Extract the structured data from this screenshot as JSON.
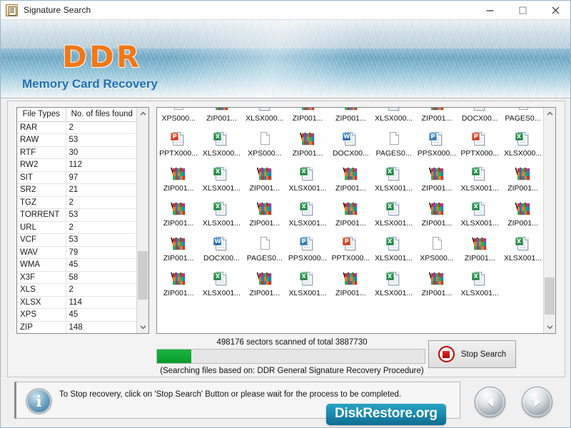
{
  "window": {
    "title": "Signature Search",
    "icon": "app-document-icon",
    "controls": {
      "minimize": "minimize-icon",
      "maximize": "maximize-icon",
      "close": "close-icon"
    }
  },
  "banner": {
    "logo": "DDR",
    "product_title": "Memory Card Recovery",
    "logo_color": "#f07818",
    "title_color": "#1f6fb5"
  },
  "file_types_table": {
    "headers": [
      "File Types",
      "No. of files found"
    ],
    "rows": [
      {
        "type": "RAR",
        "count": "2"
      },
      {
        "type": "RAW",
        "count": "53"
      },
      {
        "type": "RTF",
        "count": "30"
      },
      {
        "type": "RW2",
        "count": "112"
      },
      {
        "type": "SIT",
        "count": "97"
      },
      {
        "type": "SR2",
        "count": "21"
      },
      {
        "type": "TGZ",
        "count": "2"
      },
      {
        "type": "TORRENT",
        "count": "53"
      },
      {
        "type": "URL",
        "count": "2"
      },
      {
        "type": "VCF",
        "count": "53"
      },
      {
        "type": "WAV",
        "count": "79"
      },
      {
        "type": "WMA",
        "count": "45"
      },
      {
        "type": "X3F",
        "count": "58"
      },
      {
        "type": "XLS",
        "count": "2"
      },
      {
        "type": "XLSX",
        "count": "114"
      },
      {
        "type": "XPS",
        "count": "45"
      },
      {
        "type": "ZIP",
        "count": "148"
      }
    ]
  },
  "file_grid": {
    "columns": 9,
    "items": [
      {
        "label": "XPS000...",
        "icon": "xps-file-icon"
      },
      {
        "label": "ZIP001...",
        "icon": "zip-file-icon"
      },
      {
        "label": "XLSX000...",
        "icon": "xlsx-file-icon"
      },
      {
        "label": "ZIP001...",
        "icon": "zip-file-icon"
      },
      {
        "label": "ZIP001...",
        "icon": "zip-file-icon"
      },
      {
        "label": "XLSX000...",
        "icon": "xlsx-file-icon"
      },
      {
        "label": "ZIP001...",
        "icon": "zip-file-icon"
      },
      {
        "label": "DOCX00...",
        "icon": "docx-file-icon"
      },
      {
        "label": "PAGES0...",
        "icon": "pages-file-icon"
      },
      {
        "label": "PPTX000...",
        "icon": "pptx-file-icon"
      },
      {
        "label": "XLSX000...",
        "icon": "xlsx-file-icon"
      },
      {
        "label": "XPS000...",
        "icon": "xps-file-icon"
      },
      {
        "label": "ZIP001...",
        "icon": "zip-file-icon"
      },
      {
        "label": "DOCX00...",
        "icon": "docx-file-icon"
      },
      {
        "label": "PAGES0...",
        "icon": "pages-file-icon"
      },
      {
        "label": "PPSX000...",
        "icon": "ppsx-file-icon"
      },
      {
        "label": "PPTX000...",
        "icon": "pptx-file-icon"
      },
      {
        "label": "XLSX000...",
        "icon": "xlsx-file-icon"
      },
      {
        "label": "ZIP001...",
        "icon": "zip-file-icon"
      },
      {
        "label": "XLSX001...",
        "icon": "xlsx-file-icon"
      },
      {
        "label": "ZIP001...",
        "icon": "zip-file-icon"
      },
      {
        "label": "XLSX001...",
        "icon": "xlsx-file-icon"
      },
      {
        "label": "ZIP001...",
        "icon": "zip-file-icon"
      },
      {
        "label": "XLSX001...",
        "icon": "xlsx-file-icon"
      },
      {
        "label": "ZIP001...",
        "icon": "zip-file-icon"
      },
      {
        "label": "XLSX001...",
        "icon": "xlsx-file-icon"
      },
      {
        "label": "ZIP001...",
        "icon": "zip-file-icon"
      },
      {
        "label": "ZIP001...",
        "icon": "zip-file-icon"
      },
      {
        "label": "XLSX001...",
        "icon": "xlsx-file-icon"
      },
      {
        "label": "ZIP001...",
        "icon": "zip-file-icon"
      },
      {
        "label": "XLSX001...",
        "icon": "xlsx-file-icon"
      },
      {
        "label": "ZIP001...",
        "icon": "zip-file-icon"
      },
      {
        "label": "XLSX001...",
        "icon": "xlsx-file-icon"
      },
      {
        "label": "ZIP001...",
        "icon": "zip-file-icon"
      },
      {
        "label": "XLSX001...",
        "icon": "xlsx-file-icon"
      },
      {
        "label": "ZIP001...",
        "icon": "zip-file-icon"
      },
      {
        "label": "ZIP001...",
        "icon": "zip-file-icon"
      },
      {
        "label": "DOCX00...",
        "icon": "docx-file-icon"
      },
      {
        "label": "PAGES0...",
        "icon": "pages-file-icon"
      },
      {
        "label": "PPSX000...",
        "icon": "ppsx-file-icon"
      },
      {
        "label": "PPTX000...",
        "icon": "pptx-file-icon"
      },
      {
        "label": "XLSX001...",
        "icon": "xlsx-file-icon"
      },
      {
        "label": "XPS000...",
        "icon": "xps-file-icon"
      },
      {
        "label": "ZIP001...",
        "icon": "zip-file-icon"
      },
      {
        "label": "XLSX001...",
        "icon": "xlsx-file-icon"
      },
      {
        "label": "ZIP001...",
        "icon": "zip-file-icon"
      },
      {
        "label": "XLSX001...",
        "icon": "xlsx-file-icon"
      },
      {
        "label": "ZIP001...",
        "icon": "zip-file-icon"
      },
      {
        "label": "XLSX001...",
        "icon": "xlsx-file-icon"
      },
      {
        "label": "ZIP001...",
        "icon": "zip-file-icon"
      },
      {
        "label": "XLSX001...",
        "icon": "xlsx-file-icon"
      },
      {
        "label": "ZIP001...",
        "icon": "zip-file-icon"
      },
      {
        "label": "XLSX001...",
        "icon": "xlsx-file-icon"
      }
    ]
  },
  "progress": {
    "sectors_text": "498176 sectors scanned of total 3887730",
    "scanned": 498176,
    "total": 3887730,
    "percent": 12.8,
    "bar_color": "#12a531",
    "procedure_text": "(Searching files based on:  DDR General Signature Recovery Procedure)"
  },
  "stop_button": {
    "label": "Stop Search",
    "icon": "stop-square-icon"
  },
  "status_bar": {
    "icon": "info-icon",
    "message": "To Stop recovery, click on 'Stop Search' Button or please wait for the process to be completed."
  },
  "brand": {
    "label": "DiskRestore.org",
    "color": "#1a89ad"
  },
  "nav": {
    "prev": "previous-arrow-icon",
    "next": "next-arrow-icon"
  }
}
